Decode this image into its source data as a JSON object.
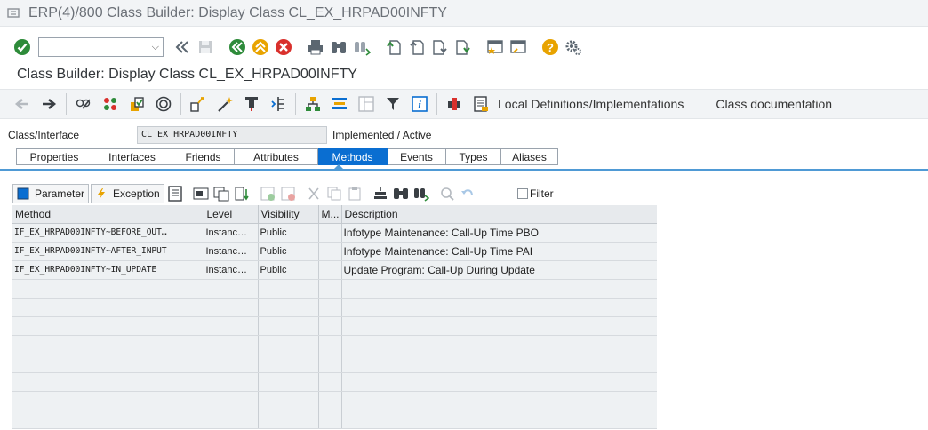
{
  "window": {
    "title": "ERP(4)/800 Class Builder: Display Class CL_EX_HRPAD00INFTY",
    "icon": "window-menu-icon"
  },
  "toolbar": {
    "command_field": ""
  },
  "screen_title": "Class Builder: Display Class CL_EX_HRPAD00INFTY",
  "app_toolbar": {
    "local_definitions_label": "Local Definitions/Implementations",
    "class_documentation_label": "Class documentation"
  },
  "header": {
    "class_label": "Class/Interface",
    "class_value": "CL_EX_HRPAD00INFTY",
    "status": "Implemented / Active"
  },
  "tabs": [
    "Properties",
    "Interfaces",
    "Friends",
    "Attributes",
    "Methods",
    "Events",
    "Types",
    "Aliases"
  ],
  "active_tab": "Methods",
  "methods_toolbar": {
    "parameter_label": "Parameter",
    "exception_label": "Exception",
    "filter_label": "Filter"
  },
  "grid": {
    "columns": [
      "Method",
      "Level",
      "Visibility",
      "M...",
      "Description"
    ],
    "rows": [
      [
        "IF_EX_HRPAD00INFTY~BEFORE_OUT…",
        "Instanc…",
        "Public",
        "",
        "Infotype Maintenance: Call-Up Time PBO"
      ],
      [
        "IF_EX_HRPAD00INFTY~AFTER_INPUT",
        "Instanc…",
        "Public",
        "",
        "Infotype Maintenance: Call-Up Time PAI"
      ],
      [
        "IF_EX_HRPAD00INFTY~IN_UPDATE",
        "Instanc…",
        "Public",
        "",
        "Update Program: Call-Up During Update"
      ]
    ],
    "empty_rows": 8
  },
  "colors": {
    "accent": "#0a6ed1",
    "ok_green": "#2e8b3a",
    "cancel_red": "#d9302c",
    "help_yellow": "#e8a300"
  }
}
